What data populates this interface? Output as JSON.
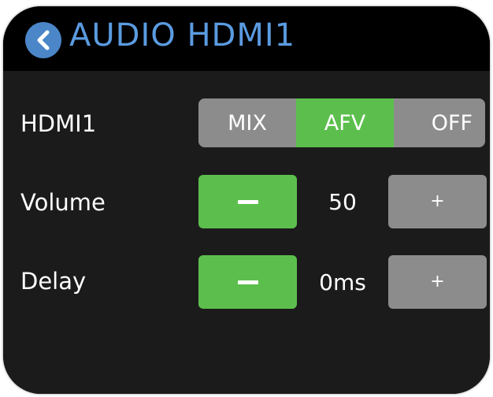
{
  "header": {
    "title": "AUDIO HDMI1",
    "back_icon": "chevron-left-icon"
  },
  "hdmi_row": {
    "label": "HDMI1",
    "options": [
      {
        "label": "MIX",
        "selected": false
      },
      {
        "label": "AFV",
        "selected": true
      },
      {
        "label": "OFF",
        "selected": false
      }
    ]
  },
  "volume_row": {
    "label": "Volume",
    "value": "50",
    "minus_icon": "minus-icon",
    "plus_label": "+"
  },
  "delay_row": {
    "label": "Delay",
    "value": "0ms",
    "minus_icon": "minus-icon",
    "plus_label": "+"
  },
  "colors": {
    "accent_green": "#5cbf4d",
    "button_gray": "#8c8c8c",
    "title_blue": "#5b9be0",
    "back_button_blue": "#4b86c8",
    "panel_bg": "#1b1b1b",
    "header_bg": "#000000"
  }
}
